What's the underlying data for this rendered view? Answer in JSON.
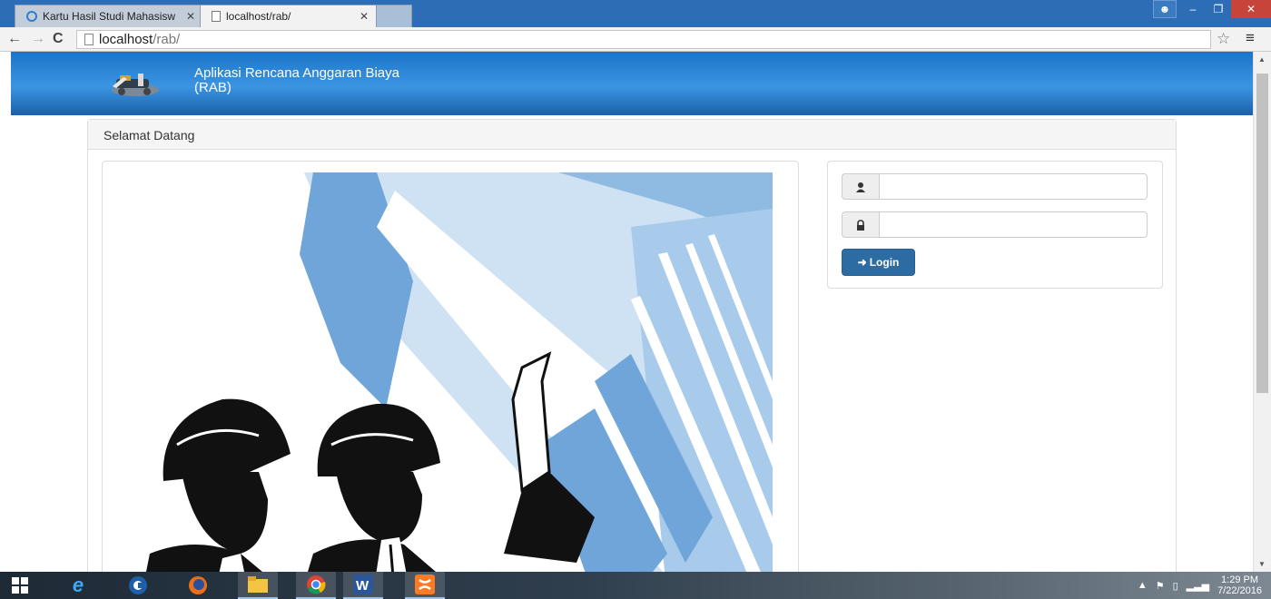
{
  "browser": {
    "tabs": [
      {
        "title": "Kartu Hasil Studi Mahasisw",
        "active": false
      },
      {
        "title": "localhost/rab/",
        "active": true
      }
    ],
    "address": {
      "host": "localhost",
      "path": "/rab/"
    }
  },
  "app": {
    "title_line1": "Aplikasi Rencana Anggaran Biaya",
    "title_line2": "(RAB)"
  },
  "panel": {
    "heading": "Selamat Datang"
  },
  "login": {
    "username_value": "",
    "password_value": "",
    "button_label": "Login"
  },
  "taskbar": {
    "apps": [
      "start-icon",
      "internet-explorer-icon",
      "ccleaner-icon",
      "firefox-icon",
      "file-explorer-icon",
      "chrome-icon",
      "word-icon",
      "xampp-icon"
    ],
    "time": "1:29 PM",
    "date": "7/22/2016"
  },
  "colors": {
    "header_blue": "#1d73c7",
    "button_blue": "#2d6ca2",
    "illustration_blue": "#6fa5d8"
  }
}
